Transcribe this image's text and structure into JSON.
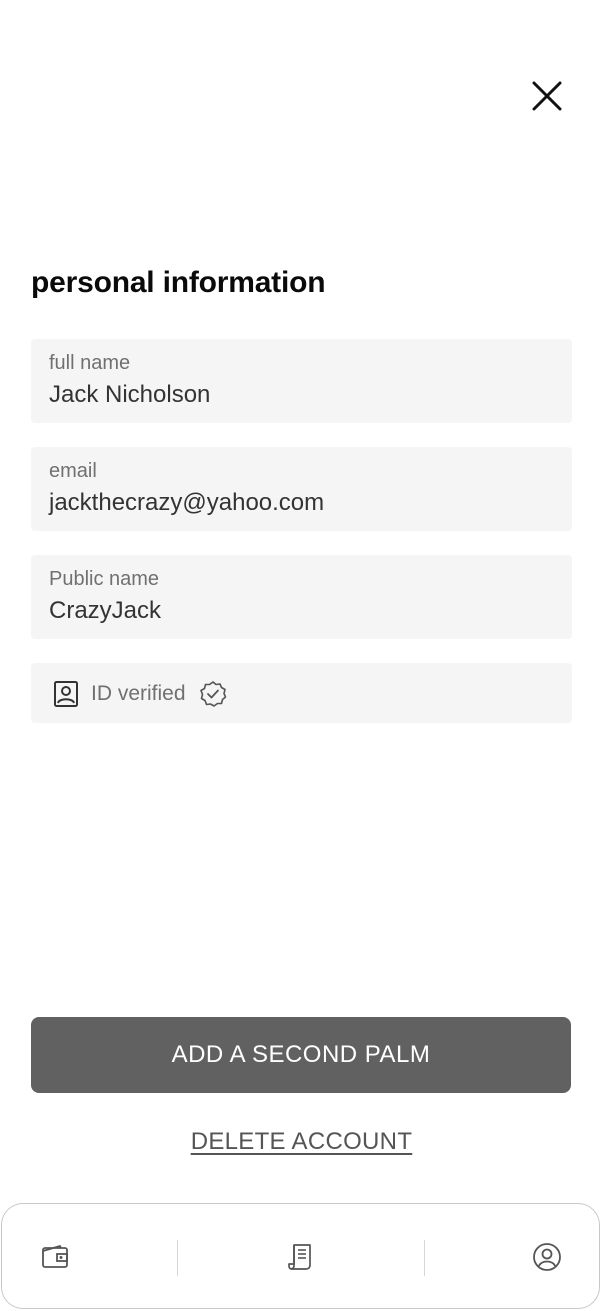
{
  "header": {
    "close_icon": "close-icon"
  },
  "section": {
    "title": "personal information"
  },
  "fields": {
    "full_name": {
      "label": "full name",
      "value": "Jack Nicholson"
    },
    "email": {
      "label": "email",
      "value": "jackthecrazy@yahoo.com"
    },
    "public_name": {
      "label": "Public name",
      "value": "CrazyJack"
    }
  },
  "verification": {
    "icon": "id-card-icon",
    "text": "ID verified",
    "badge_icon": "verified-badge-icon"
  },
  "actions": {
    "add_palm_label": "ADD A SECOND PALM",
    "delete_label": "DELETE ACCOUNT"
  },
  "bottom_nav": {
    "items": [
      {
        "icon": "wallet-icon"
      },
      {
        "icon": "receipt-icon"
      },
      {
        "icon": "profile-icon"
      }
    ]
  },
  "colors": {
    "primary_button": "#616161",
    "field_background": "#f5f5f5",
    "title_text": "#0a0a0a"
  }
}
